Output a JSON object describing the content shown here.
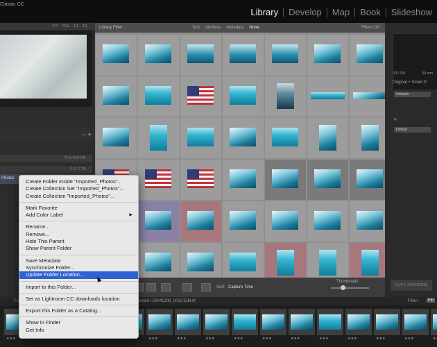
{
  "app": {
    "title": "Classic CC"
  },
  "modules": [
    "Library",
    "Develop",
    "Map",
    "Book",
    "Slideshow"
  ],
  "active_module": "Library",
  "navigator": {
    "zoom_opts": [
      "FIT",
      "FILL",
      "1:1",
      "3:1"
    ]
  },
  "left_panel": {
    "plus": "+",
    "minus": "–",
    "volume1": "79.8 / 500 GB",
    "volume2": "0.6 / 2 TB",
    "folder_label": "Photos"
  },
  "filter_bar": {
    "label": "Library Filter :",
    "options": [
      "Text",
      "Attribute",
      "Metadata",
      "None"
    ],
    "active": "None",
    "status": "Filters Off"
  },
  "grid_thumbs": [
    {
      "shape": "land",
      "style": "glacier",
      "bg": "selected"
    },
    {
      "shape": "land",
      "style": "glacier",
      "bg": "selected"
    },
    {
      "shape": "land",
      "style": "boat",
      "bg": "selected"
    },
    {
      "shape": "land",
      "style": "boat",
      "bg": "selected"
    },
    {
      "shape": "land",
      "style": "boat",
      "bg": "selected"
    },
    {
      "shape": "land",
      "style": "glacier",
      "bg": "selected"
    },
    {
      "shape": "land",
      "style": "glacier",
      "bg": "selected"
    },
    {
      "shape": "land",
      "style": "glacier",
      "bg": "selected"
    },
    {
      "shape": "land",
      "style": "water",
      "bg": "selected"
    },
    {
      "shape": "land",
      "style": "flag",
      "bg": "selected"
    },
    {
      "shape": "land",
      "style": "water",
      "bg": "selected"
    },
    {
      "shape": "port",
      "style": "dark",
      "bg": "selected"
    },
    {
      "shape": "pano",
      "style": "water",
      "bg": "selected"
    },
    {
      "shape": "pano",
      "style": "glacier",
      "bg": "selected"
    },
    {
      "shape": "land",
      "style": "glacier",
      "bg": "selected"
    },
    {
      "shape": "port",
      "style": "water",
      "bg": "selected"
    },
    {
      "shape": "land",
      "style": "water",
      "bg": "selected"
    },
    {
      "shape": "land",
      "style": "glacier",
      "bg": "selected"
    },
    {
      "shape": "land",
      "style": "water",
      "bg": "selected"
    },
    {
      "shape": "port",
      "style": "glacier",
      "bg": "selected"
    },
    {
      "shape": "port",
      "style": "glacier",
      "bg": "selected"
    },
    {
      "shape": "land",
      "style": "flag",
      "bg": "selected"
    },
    {
      "shape": "land",
      "style": "flag",
      "bg": "selected"
    },
    {
      "shape": "land",
      "style": "flag",
      "bg": "selected"
    },
    {
      "shape": "land",
      "style": "glacier",
      "bg": "selected"
    },
    {
      "shape": "land",
      "style": "glacier",
      "bg": "plain"
    },
    {
      "shape": "land",
      "style": "glacier",
      "bg": "plain"
    },
    {
      "shape": "land",
      "style": "glacier",
      "bg": "plain"
    },
    {
      "shape": "land",
      "style": "water",
      "bg": "selected"
    },
    {
      "shape": "land",
      "style": "glacier",
      "bg": "purple"
    },
    {
      "shape": "land",
      "style": "glacier",
      "bg": "red"
    },
    {
      "shape": "land",
      "style": "glacier",
      "bg": "selected"
    },
    {
      "shape": "land",
      "style": "glacier",
      "bg": "selected"
    },
    {
      "shape": "land",
      "style": "glacier",
      "bg": "selected"
    },
    {
      "shape": "land",
      "style": "glacier",
      "bg": "selected"
    },
    {
      "shape": "land",
      "style": "glacier",
      "bg": "selected"
    },
    {
      "shape": "land",
      "style": "glacier",
      "bg": "selected"
    },
    {
      "shape": "land",
      "style": "glacier",
      "bg": "selected"
    },
    {
      "shape": "land",
      "style": "water",
      "bg": "selected"
    },
    {
      "shape": "port",
      "style": "water",
      "bg": "red"
    },
    {
      "shape": "port",
      "style": "water",
      "bg": "selected"
    },
    {
      "shape": "port",
      "style": "water",
      "bg": "red"
    }
  ],
  "toolbar": {
    "sort_label": "Sort:",
    "sort_value": "Capture Time",
    "thumbnails_label": "Thumbnails",
    "thumb_size": 0.3
  },
  "right_panel": {
    "iso": "ISO 200",
    "focal": "60 mm",
    "original": "Original + Smart P",
    "preset1": "Defaults",
    "preset2": "Default",
    "plus": "+",
    "sync_label": "Sync Metadata"
  },
  "filmstrip": {
    "folder_prefix": "Fo",
    "path": "ected / 20041208_0012-Edit.tif",
    "filter_label": "Filter :",
    "filter_value": "Filt",
    "stars": "★★★"
  },
  "context_menu": {
    "groups": [
      [
        "Create Folder Inside \"Imported_Photos\"...",
        "Create Collection Set \"Imported_Photos\"...",
        "Create Collection \"Imported_Photos\"..."
      ],
      [
        "Mark Favorite",
        "Add Color Label"
      ],
      [
        "Rename...",
        "Remove...",
        "Hide This Parent",
        "Show Parent Folder"
      ],
      [
        "Save Metadata",
        "Synchronize Folder...",
        "Update Folder Location..."
      ],
      [
        "Import to this Folder..."
      ],
      [
        "Set as Lightroom CC downloads location"
      ],
      [
        "Export this Folder as a Catalog..."
      ],
      [
        "Show in Finder",
        "Get Info"
      ]
    ],
    "highlighted": "Update Folder Location...",
    "submenu_items": [
      "Add Color Label"
    ],
    "submenu_arrow": "▶"
  }
}
